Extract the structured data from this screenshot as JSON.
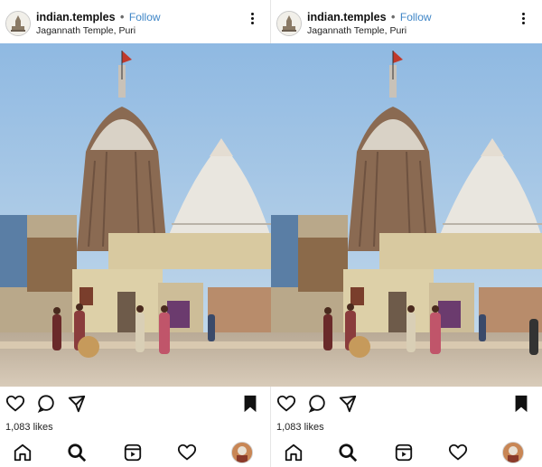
{
  "posts": [
    {
      "username": "indian.temples",
      "separator": "•",
      "follow_label": "Follow",
      "location": "Jagannath Temple, Puri",
      "likes": "1,083 likes"
    },
    {
      "username": "indian.temples",
      "separator": "•",
      "follow_label": "Follow",
      "location": "Jagannath Temple, Puri",
      "likes": "1,083 likes"
    }
  ],
  "icons": {
    "header": [
      "avatar",
      "more-options-icon"
    ],
    "actions": [
      "heart-icon",
      "comment-icon",
      "share-icon",
      "bookmark-icon"
    ],
    "nav": [
      "home-icon",
      "search-icon",
      "reels-icon",
      "activity-heart-icon",
      "profile-avatar"
    ]
  },
  "colors": {
    "follow": "#3f86c7",
    "sky": "#9ec4e6",
    "temple_stone": "#8a6a52",
    "white_temple": "#e9e6df",
    "ground": "#c9b9a5"
  }
}
